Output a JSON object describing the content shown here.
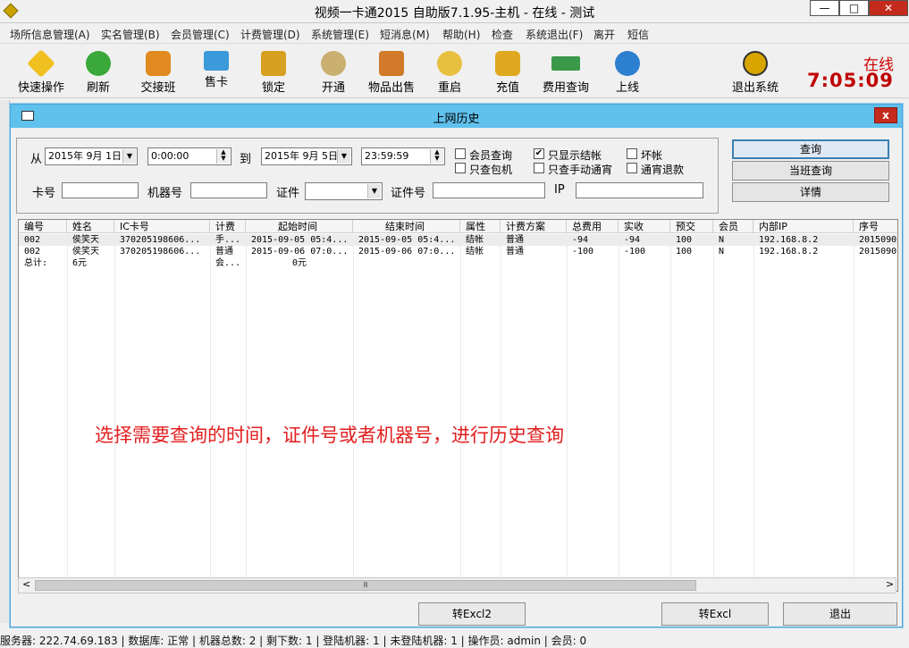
{
  "window": {
    "title": "视频一卡通2015 自助版7.1.95-主机 - 在线 - 测试",
    "minimize": "—",
    "maximize": "□",
    "close": "✕"
  },
  "menu": [
    "场所信息管理(A)",
    "实名管理(B)",
    "会员管理(C)",
    "计费管理(D)",
    "系统管理(E)",
    "短消息(M)",
    "帮助(H)",
    "检查",
    "系统退出(F)",
    "离开",
    "短信"
  ],
  "toolbar": {
    "buttons": [
      {
        "label": "快速操作",
        "icon": "star-icon",
        "color": "#f0c020"
      },
      {
        "label": "刷新",
        "icon": "refresh-icon",
        "color": "#3aa83a"
      },
      {
        "label": "交接班",
        "icon": "handover-icon",
        "color": "#e08a20"
      },
      {
        "label": "售卡",
        "icon": "card-icon",
        "color": "#3b9ad9"
      },
      {
        "label": "锁定",
        "icon": "lock-icon",
        "color": "#d8a020"
      },
      {
        "label": "开通",
        "icon": "key-icon",
        "color": "#c9b070"
      },
      {
        "label": "物品出售",
        "icon": "goods-icon",
        "color": "#d07a2a"
      },
      {
        "label": "重启",
        "icon": "restart-icon",
        "color": "#e8c040"
      },
      {
        "label": "充值",
        "icon": "coins-icon",
        "color": "#e0a820"
      },
      {
        "label": "费用查询",
        "icon": "money-icon",
        "color": "#3a9a4a"
      },
      {
        "label": "上线",
        "icon": "globe-icon",
        "color": "#2d7fd0"
      },
      {
        "label": "退出系统",
        "icon": "exit-icon",
        "color": "#d8a400"
      }
    ],
    "status": "在线",
    "clock": "7:05:09"
  },
  "dialog": {
    "title": "上网历史",
    "close": "x",
    "filter": {
      "from_label": "从",
      "from_date": "2015年 9月 1日",
      "from_time": "0:00:00",
      "to_label": "到",
      "to_date": "2015年 9月 5日",
      "to_time": "23:59:59",
      "checkboxes": [
        {
          "label": "会员查询",
          "checked": false
        },
        {
          "label": "只显示结帐",
          "checked": true
        },
        {
          "label": "坏帐",
          "checked": false
        },
        {
          "label": "只查包机",
          "checked": false
        },
        {
          "label": "只查手动通宵",
          "checked": false
        },
        {
          "label": "通宵退款",
          "checked": false
        }
      ],
      "card_label": "卡号",
      "card_value": "",
      "machine_label": "机器号",
      "machine_value": "",
      "id_type_label": "证件",
      "id_type_value": "",
      "id_no_label": "证件号",
      "id_no_value": "",
      "ip_label": "IP",
      "ip_value": ""
    },
    "side_buttons": [
      "查询",
      "当班查询",
      "详情"
    ],
    "table": {
      "columns": [
        "编号",
        "姓名",
        "IC卡号",
        "计费",
        "起始时间",
        "结束时间",
        "属性",
        "计费方案",
        "总费用",
        "实收",
        "预交",
        "会员",
        "内部IP",
        "序号"
      ],
      "rows": [
        [
          "002",
          "侯笑天",
          "370205198606...",
          "手...",
          "2015-09-05 05:4...",
          "2015-09-05 05:4...",
          "结帐",
          "普通",
          "-94",
          "-94",
          "100",
          "N",
          "192.168.8.2",
          "2015090"
        ],
        [
          "002",
          "侯笑天",
          "370205198606...",
          "普通",
          "2015-09-06 07:0...",
          "2015-09-06 07:0...",
          "结帐",
          "普通",
          "-100",
          "-100",
          "100",
          "N",
          "192.168.8.2",
          "2015090"
        ]
      ],
      "total": {
        "label": "总计:",
        "name_col": "6元",
        "billing_col": "会...",
        "start_col": "0元"
      }
    },
    "annotation": "选择需要查询的时间，证件号或者机器号，进行历史查询",
    "bottom_buttons": [
      "转Excl2",
      "转Excl",
      "退出"
    ],
    "scroll": {
      "left": "<",
      "right": ">",
      "thumb": "Ⅲ"
    }
  },
  "statusbar": "服务器: 222.74.69.183 | 数据库: 正常 | 机器总数: 2 | 剩下数: 1 | 登陆机器: 1 | 未登陆机器: 1 | 操作员: admin | 会员: 0"
}
